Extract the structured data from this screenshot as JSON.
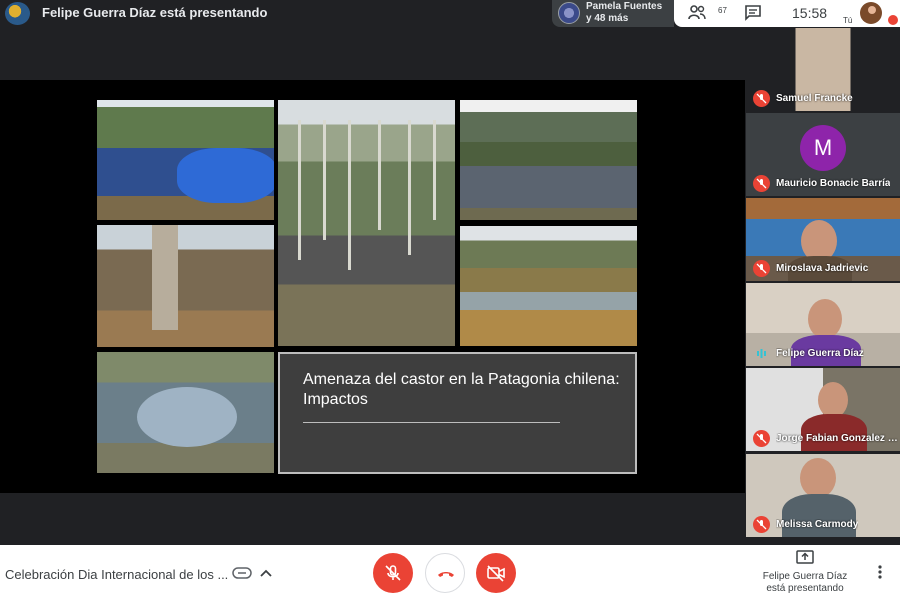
{
  "topbar": {
    "presenter_title": "Felipe Guerra Díaz está presentando",
    "participants_preview": {
      "line1": "Pamela Fuentes",
      "line2": "y 48 más"
    },
    "people_count": "67",
    "clock": "15:58",
    "self_label": "Tú"
  },
  "slide": {
    "title": "Amenaza del castor en la Patagonia chilena: Impactos"
  },
  "tiles": [
    {
      "name": "Samuel Francke",
      "muted": true
    },
    {
      "name": "Mauricio Bonacic Barría",
      "muted": true,
      "avatar_letter": "M",
      "avatar_color": "#8e24aa"
    },
    {
      "name": "Miroslava Jadrievic",
      "muted": true
    },
    {
      "name": "Felipe Guerra Díaz",
      "muted": false,
      "speaking": true
    },
    {
      "name": "Jorge Fabian Gonzalez G...",
      "muted": true
    },
    {
      "name": "Melissa Carmody",
      "muted": true
    }
  ],
  "bottombar": {
    "meeting_title": "Celebración Dia Internacional de los ...",
    "presenting_line1": "Felipe Guerra Díaz",
    "presenting_line2": "está presentando"
  },
  "colors": {
    "danger": "#ea4335",
    "accent_purple": "#8e24aa",
    "surface_dark": "#202124",
    "speaking_teal": "#34c3d4"
  },
  "icons": [
    "people-icon",
    "chat-icon",
    "mic-off-icon",
    "hangup-icon",
    "camera-off-icon",
    "present-screen-icon",
    "more-vert-icon",
    "details-icon",
    "chevron-up-icon"
  ]
}
